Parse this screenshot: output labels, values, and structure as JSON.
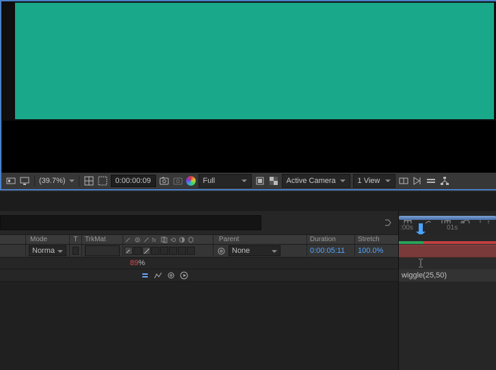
{
  "viewer": {
    "zoom": "(39.7%)",
    "timecode": "0:00:00:09",
    "resolution": "Full",
    "camera": "Active Camera",
    "view": "1 View"
  },
  "timeline": {
    "search_placeholder": "",
    "columns": {
      "mode": "Mode",
      "t": "T",
      "trkmat": "TrkMat",
      "parent": "Parent",
      "duration": "Duration",
      "stretch": "Stretch"
    },
    "ruler": {
      "t0": ":00s",
      "t1": "01s"
    },
    "layer": {
      "mode": "Norma",
      "parent": "None",
      "duration": "0:00:05:11",
      "stretch": "100.0%"
    },
    "property": {
      "value_number": "89",
      "value_unit": "%"
    },
    "expression": {
      "text": "wiggle(25,50)"
    }
  }
}
